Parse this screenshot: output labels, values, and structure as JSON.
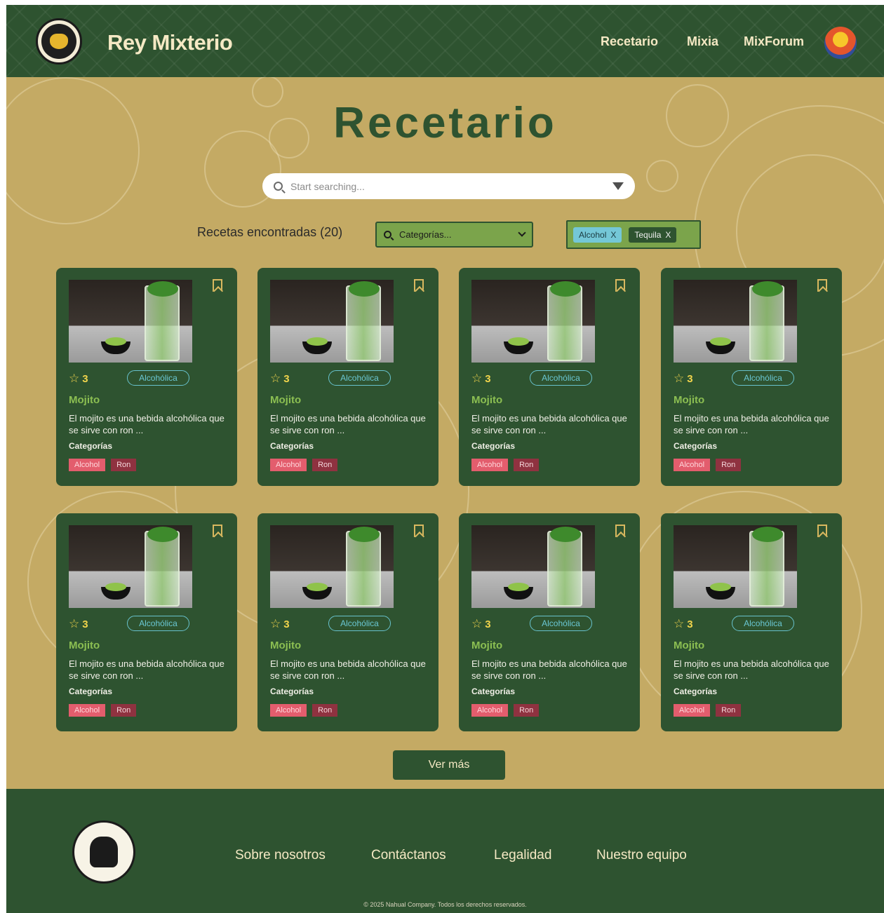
{
  "header": {
    "brand": "Rey Mixterio",
    "nav": [
      "Recetario",
      "Mixia",
      "MixForum"
    ]
  },
  "page": {
    "title": "Recetario",
    "search_placeholder": "Start searching...",
    "results_label": "Recetas encontradas (20)",
    "category_select": "Categorías...",
    "active_filters": [
      "Alcohol",
      "Tequila"
    ],
    "more_button": "Ver más"
  },
  "cards": [
    {
      "rating": "3",
      "badge": "Alcohólica",
      "name": "Mojito",
      "desc": "El mojito es una bebida alcohólica que se sirve con ron ...",
      "cat_label": "Categorías",
      "tags": [
        "Alcohol",
        "Ron"
      ]
    },
    {
      "rating": "3",
      "badge": "Alcohólica",
      "name": "Mojito",
      "desc": "El mojito es una bebida alcohólica que se sirve con ron ...",
      "cat_label": "Categorías",
      "tags": [
        "Alcohol",
        "Ron"
      ]
    },
    {
      "rating": "3",
      "badge": "Alcohólica",
      "name": "Mojito",
      "desc": "El mojito es una bebida alcohólica que se sirve con ron ...",
      "cat_label": "Categorías",
      "tags": [
        "Alcohol",
        "Ron"
      ]
    },
    {
      "rating": "3",
      "badge": "Alcohólica",
      "name": "Mojito",
      "desc": "El mojito es una bebida alcohólica que se sirve con ron ...",
      "cat_label": "Categorías",
      "tags": [
        "Alcohol",
        "Ron"
      ]
    },
    {
      "rating": "3",
      "badge": "Alcohólica",
      "name": "Mojito",
      "desc": "El mojito es una bebida alcohólica que se sirve con ron ...",
      "cat_label": "Categorías",
      "tags": [
        "Alcohol",
        "Ron"
      ]
    },
    {
      "rating": "3",
      "badge": "Alcohólica",
      "name": "Mojito",
      "desc": "El mojito es una bebida alcohólica que se sirve con ron ...",
      "cat_label": "Categorías",
      "tags": [
        "Alcohol",
        "Ron"
      ]
    },
    {
      "rating": "3",
      "badge": "Alcohólica",
      "name": "Mojito",
      "desc": "El mojito es una bebida alcohólica que se sirve con ron ...",
      "cat_label": "Categorías",
      "tags": [
        "Alcohol",
        "Ron"
      ]
    },
    {
      "rating": "3",
      "badge": "Alcohólica",
      "name": "Mojito",
      "desc": "El mojito es una bebida alcohólica que se sirve con ron ...",
      "cat_label": "Categorías",
      "tags": [
        "Alcohol",
        "Ron"
      ]
    }
  ],
  "footer": {
    "links": [
      "Sobre nosotros",
      "Contáctanos",
      "Legalidad",
      "Nuestro equipo"
    ],
    "copyright": "© 2025 Nahual Company. Todos los derechos reservados."
  },
  "icons": {
    "search": "search-icon",
    "filter": "filter-icon",
    "bookmark": "bookmark-icon",
    "star": "star-icon",
    "chevron": "chevron-down-icon",
    "close": "close-icon"
  },
  "colors": {
    "primary_green": "#2e5330",
    "background_gold": "#c4aa64",
    "accent_cyan": "#68c2cd",
    "name_green": "#8cbf52",
    "tag_alcohol": "#e35d6d",
    "tag_ron": "#8f3240"
  }
}
